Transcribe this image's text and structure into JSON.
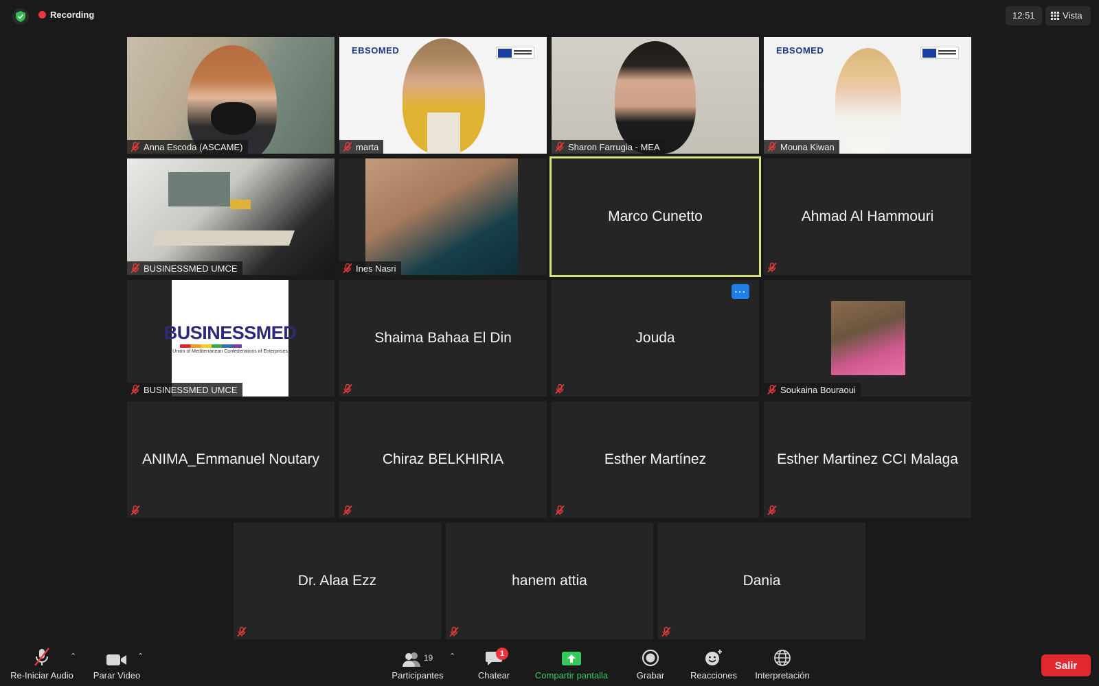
{
  "topbar": {
    "recording_label": "Recording",
    "time": "12:51",
    "view_label": "Vista"
  },
  "tiles": {
    "anna": {
      "name": "Anna Escoda (ASCAME)"
    },
    "marta": {
      "name": "marta",
      "logo": "EBSOMED"
    },
    "sharon": {
      "name": "Sharon Farrugia - MEA"
    },
    "mouna": {
      "name": "Mouna Kiwan",
      "logo": "EBSOMED"
    },
    "businessmed1": {
      "name": "BUSINESSMED UMCE"
    },
    "ines": {
      "name": "Ines Nasri"
    },
    "marco": {
      "name": "Marco Cunetto"
    },
    "ahmad": {
      "name": "Ahmad Al Hammouri"
    },
    "businessmed2": {
      "name": "BUSINESSMED UMCE",
      "logo_text": "BUSINESSMED",
      "logo_sub": "Union of Mediterranean Confederations of Enterprises"
    },
    "shaima": {
      "name": "Shaima Bahaa El Din"
    },
    "jouda": {
      "name": "Jouda",
      "more_label": "···"
    },
    "soukaina": {
      "name": "Soukaina Bouraoui"
    },
    "emmanuel": {
      "name": "ANIMA_Emmanuel Noutary"
    },
    "chiraz": {
      "name": "Chiraz BELKHIRIA"
    },
    "esther1": {
      "name": "Esther Martínez"
    },
    "esther2": {
      "name": "Esther Martinez CCI Malaga"
    },
    "alaa": {
      "name": "Dr. Alaa Ezz"
    },
    "hanem": {
      "name": "hanem attia"
    },
    "dania": {
      "name": "Dania"
    }
  },
  "toolbar": {
    "audio_label": "Re-Iniciar Audio",
    "video_label": "Parar Video",
    "participants_label": "Participantes",
    "participants_count": "19",
    "chat_label": "Chatear",
    "chat_badge": "1",
    "share_label": "Compartir pantalla",
    "record_label": "Grabar",
    "reactions_label": "Reacciones",
    "interpretation_label": "Interpretación",
    "leave_label": "Salir"
  },
  "colors": {
    "background": "#1a1a1a",
    "tile": "#252525",
    "active_speaker": "#d6e37a",
    "recording": "#e8363b",
    "share": "#36c85a",
    "leave": "#e0282e",
    "accent": "#1f7ee8"
  }
}
